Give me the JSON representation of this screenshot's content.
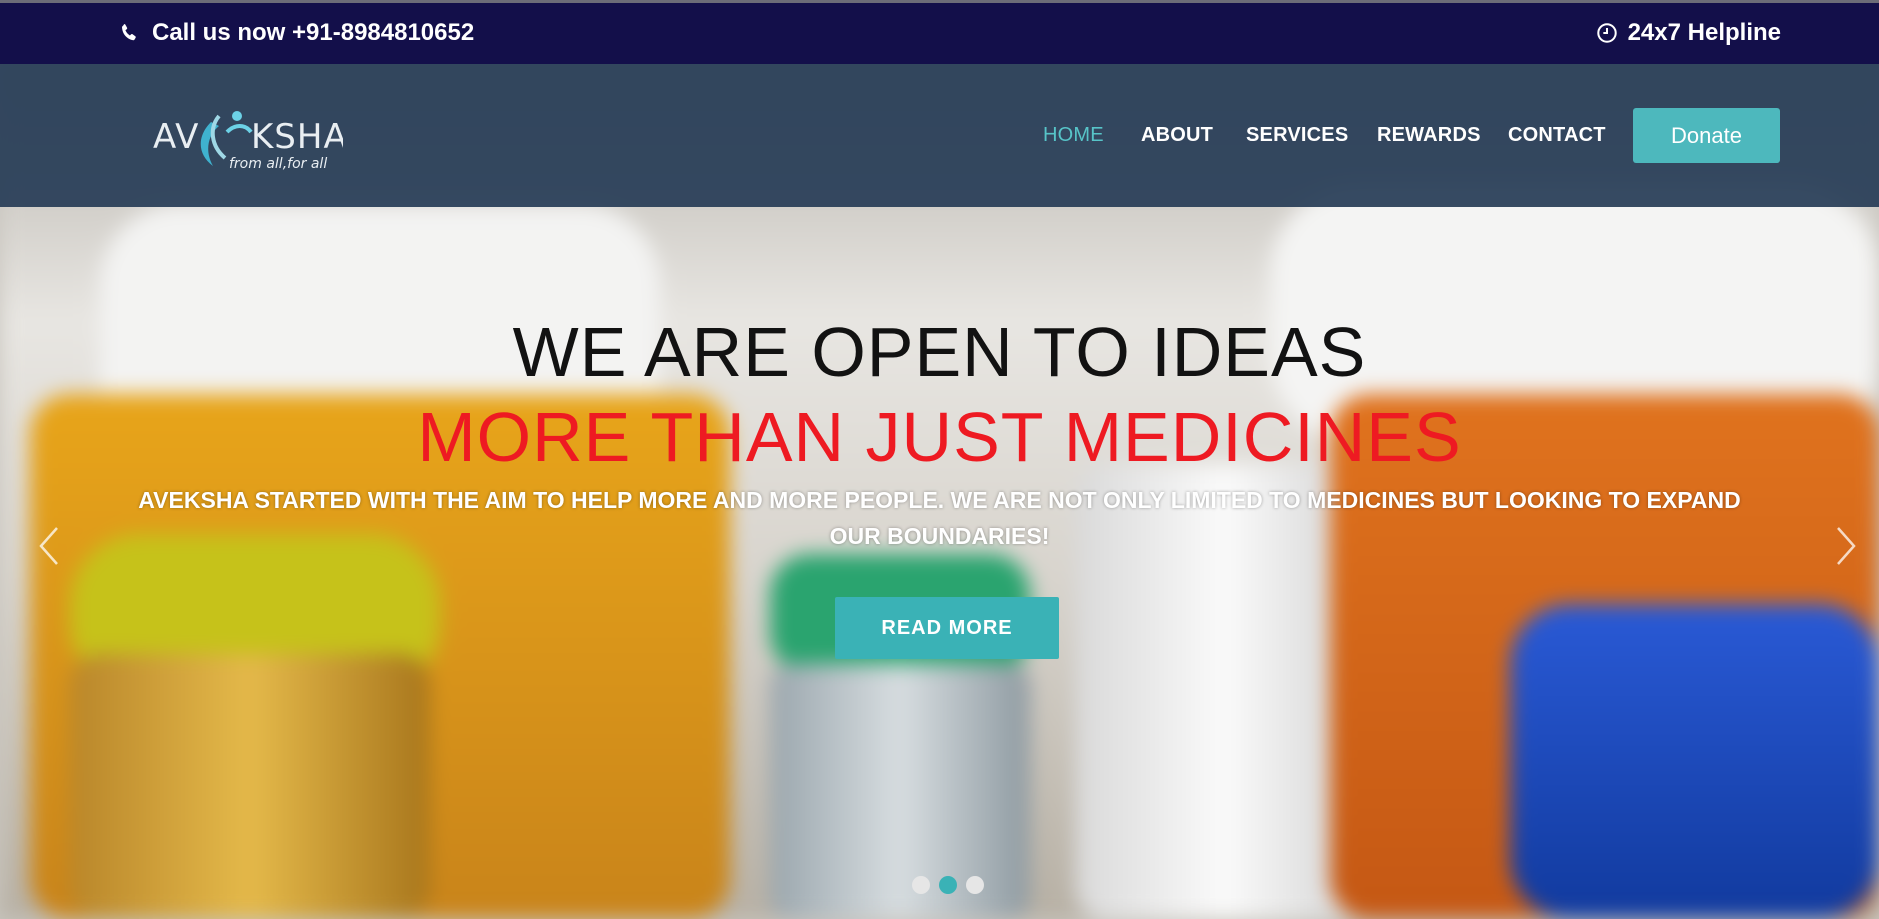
{
  "topbar": {
    "phone_text": "Call us now +91-8984810652",
    "helpline_text": "24x7 Helpline",
    "phone_icon": "phone-icon",
    "clock_icon": "clock-icon"
  },
  "brand": {
    "logo_text": "AV KSHA",
    "tagline": "from all,for all"
  },
  "nav": {
    "items": [
      {
        "label": "HOME",
        "active": true
      },
      {
        "label": "ABOUT",
        "active": false
      },
      {
        "label": "SERVICES",
        "active": false
      },
      {
        "label": "REWARDS",
        "active": false
      },
      {
        "label": "CONTACT",
        "active": false
      }
    ],
    "donate_label": "Donate"
  },
  "hero": {
    "headline_1": "WE ARE OPEN TO IDEAS",
    "headline_2": "MORE THAN JUST MEDICINES",
    "subtext": "AVEKSHA STARTED WITH THE AIM TO HELP MORE AND MORE PEOPLE. WE ARE NOT ONLY LIMITED TO MEDICINES BUT LOOKING TO EXPAND OUR BOUNDARIES!",
    "button_label": "READ MORE",
    "slide_count": 3,
    "active_slide": 2
  },
  "colors": {
    "topbar_bg": "#130f4a",
    "accent": "#4db8bd",
    "headline_red": "#ee1a22"
  }
}
